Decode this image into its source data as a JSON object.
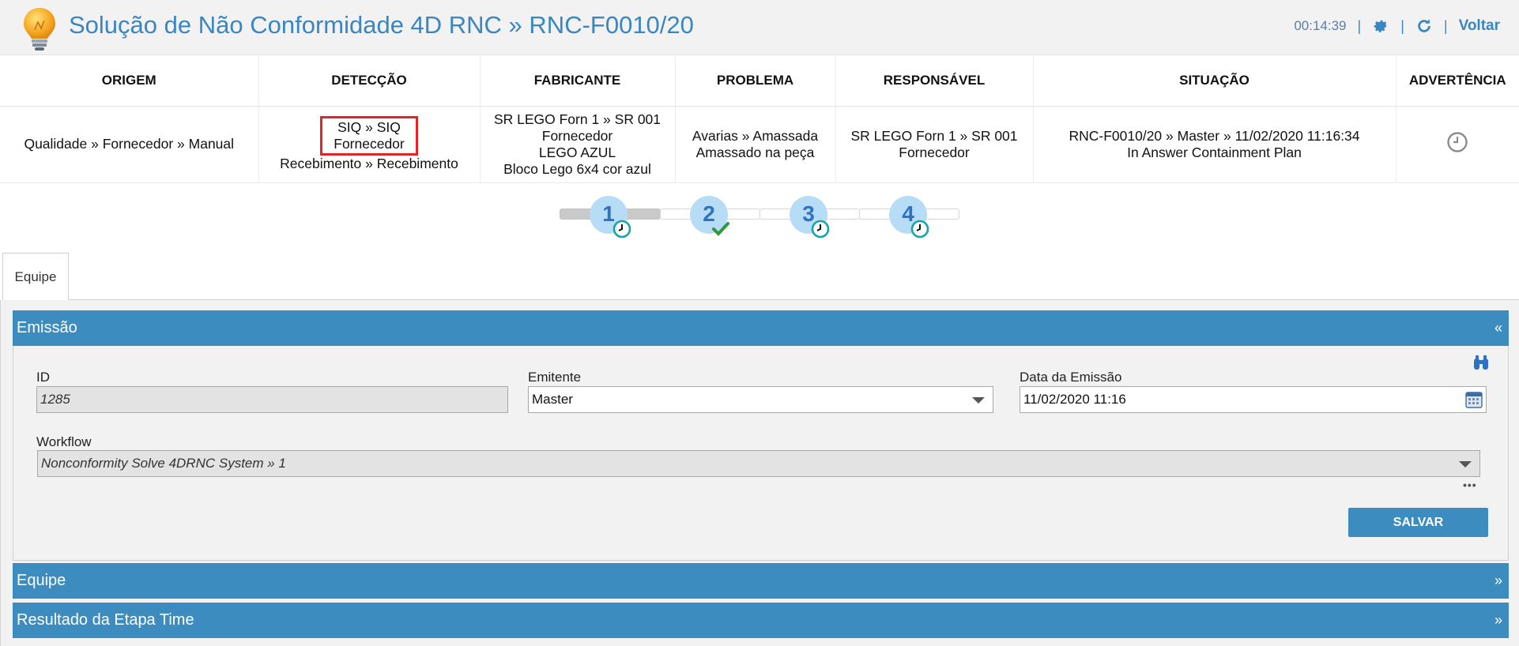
{
  "header": {
    "title": "Solução de Não Conformidade 4D RNC » RNC-F0010/20",
    "time": "00:14:39",
    "separator": "|",
    "back_label": "Voltar",
    "accent": "#3a86c0"
  },
  "info_table": {
    "headers": [
      "ORIGEM",
      "DETECÇÃO",
      "FABRICANTE",
      "PROBLEMA",
      "RESPONSÁVEL",
      "SITUAÇÃO",
      "ADVERTÊNCIA"
    ],
    "origem": "Qualidade » Fornecedor » Manual",
    "deteccao": {
      "highlight_line1": "SIQ » SIQ",
      "highlight_line2": "Fornecedor",
      "line3": "Recebimento » Recebimento"
    },
    "fabricante": [
      "SR LEGO Forn 1 » SR 001",
      "Fornecedor",
      "LEGO AZUL",
      "Bloco Lego 6x4 cor azul"
    ],
    "problema": [
      "Avarias » Amassada",
      "Amassado na peça"
    ],
    "responsavel": [
      "SR LEGO Forn 1 » SR 001",
      "Fornecedor"
    ],
    "situacao": [
      "RNC-F0010/20 » Master » 11/02/2020 11:16:34",
      "In Answer Containment Plan"
    ],
    "advertencia_icon": "clock-icon"
  },
  "stepper": {
    "steps": [
      {
        "number": "1",
        "status_icon": "clock-icon"
      },
      {
        "number": "2",
        "status_icon": "check-icon"
      },
      {
        "number": "3",
        "status_icon": "clock-icon"
      },
      {
        "number": "4",
        "status_icon": "clock-icon"
      }
    ],
    "active_step": 1
  },
  "tabs": [
    {
      "label": "Equipe",
      "selected": true
    }
  ],
  "accordion": {
    "emissao": {
      "label": "Emissão",
      "chevron": "«"
    },
    "equipe": {
      "label": "Equipe",
      "chevron": "»"
    },
    "resultado": {
      "label": "Resultado da Etapa Time",
      "chevron": "»"
    }
  },
  "form": {
    "id_label": "ID",
    "id_value": "1285",
    "emitente_label": "Emitente",
    "emitente_value": "Master",
    "data_label": "Data da Emissão",
    "data_value": "11/02/2020 11:16",
    "workflow_label": "Workflow",
    "workflow_value": "Nonconformity Solve 4DRNC System » 1",
    "more_label": "•••",
    "save_label": "SALVAR"
  }
}
